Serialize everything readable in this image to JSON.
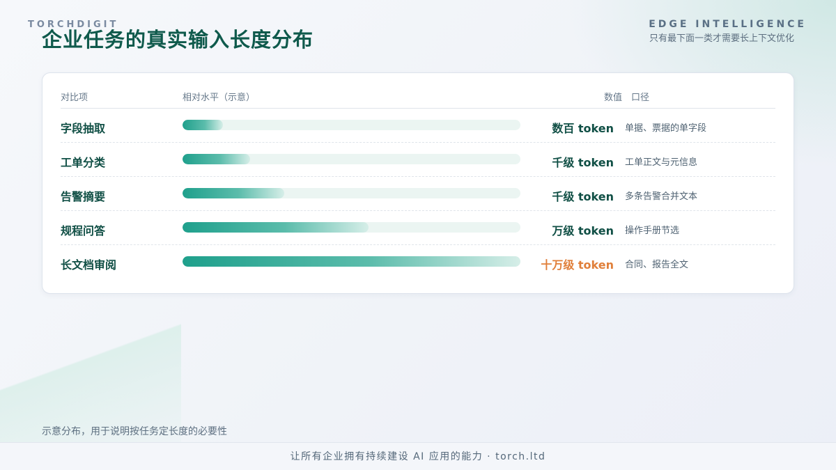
{
  "brand": "TORCHDIGIT",
  "title": "企业任务的真实输入长度分布",
  "edge": "EDGE INTELLIGENCE",
  "subtitle": "只有最下面一类才需要长上下文优化",
  "table": {
    "headers": {
      "item": "对比项",
      "level": "相对水平（示意）",
      "value": "数值　口径"
    },
    "rows": [
      {
        "label": "字段抽取",
        "level": 0.12,
        "value": "数百 token",
        "note": "单据、票据的单字段",
        "accent": false
      },
      {
        "label": "工单分类",
        "level": 0.2,
        "value": "千级 token",
        "note": "工单正文与元信息",
        "accent": false
      },
      {
        "label": "告警摘要",
        "level": 0.3,
        "value": "千级 token",
        "note": "多条告警合并文本",
        "accent": false
      },
      {
        "label": "规程问答",
        "level": 0.55,
        "value": "万级 token",
        "note": "操作手册节选",
        "accent": false
      },
      {
        "label": "长文档审阅",
        "level": 1.0,
        "value": "十万级 token",
        "note": "合同、报告全文",
        "accent": true
      }
    ]
  },
  "colors": {
    "accent": "#e07f3a",
    "primary": "#104f45",
    "bar": "#1fa08c"
  },
  "footnote": "示意分布，用于说明按任务定长度的必要性",
  "footer": "让所有企业拥有持续建设 AI 应用的能力 · torch.ltd"
}
